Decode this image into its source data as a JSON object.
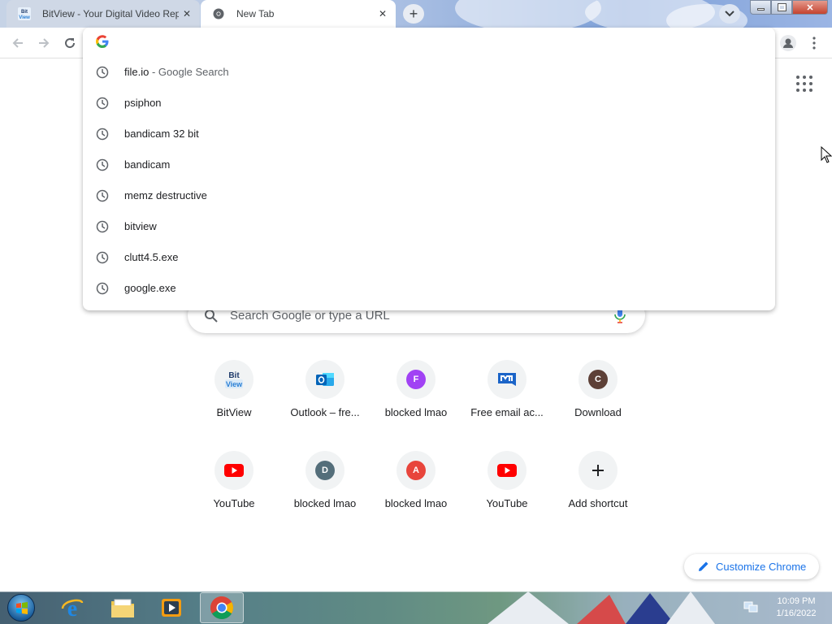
{
  "tabs": [
    {
      "title": "BitView - Your Digital Video Repository",
      "favicon": "bitview-logo",
      "active": false
    },
    {
      "title": "New Tab",
      "favicon": "chrome-icon",
      "active": true
    }
  ],
  "omnibox": {
    "value": "",
    "suggestions": [
      {
        "text": "file.io",
        "extra": " - Google Search",
        "icon": "history-clock-icon"
      },
      {
        "text": "psiphon",
        "extra": "",
        "icon": "history-clock-icon"
      },
      {
        "text": "bandicam 32 bit",
        "extra": "",
        "icon": "history-clock-icon"
      },
      {
        "text": "bandicam",
        "extra": "",
        "icon": "history-clock-icon"
      },
      {
        "text": "memz destructive",
        "extra": "",
        "icon": "history-clock-icon"
      },
      {
        "text": "bitview",
        "extra": "",
        "icon": "history-clock-icon"
      },
      {
        "text": "clutt4.5.exe",
        "extra": "",
        "icon": "history-clock-icon"
      },
      {
        "text": "google.exe",
        "extra": "",
        "icon": "history-clock-icon"
      }
    ]
  },
  "search": {
    "placeholder": "Search Google or type a URL"
  },
  "shortcuts": [
    {
      "label": "BitView",
      "icon": "bitview-logo"
    },
    {
      "label": "Outlook – fre...",
      "icon": "outlook-icon"
    },
    {
      "label": "blocked lmao",
      "icon": "letter-icon",
      "letter": "F",
      "color": "#a142f4"
    },
    {
      "label": "Free email ac...",
      "icon": "mail-com-icon"
    },
    {
      "label": "Download",
      "icon": "letter-icon",
      "letter": "C",
      "color": "#5d4037"
    },
    {
      "label": "YouTube",
      "icon": "youtube-icon"
    },
    {
      "label": "blocked lmao",
      "icon": "letter-icon",
      "letter": "D",
      "color": "#546e7a"
    },
    {
      "label": "blocked lmao",
      "icon": "letter-icon",
      "letter": "A",
      "color": "#e8453c"
    },
    {
      "label": "YouTube",
      "icon": "youtube-icon"
    },
    {
      "label": "Add shortcut",
      "icon": "plus-icon"
    }
  ],
  "customize": {
    "label": "Customize Chrome"
  },
  "taskbar": {
    "time": "10:09 PM",
    "date": "1/16/2022",
    "apps": [
      "internet-explorer-icon",
      "windows-explorer-icon",
      "media-player-icon",
      "chrome-icon"
    ]
  },
  "colors": {
    "accent": "#1a73e8",
    "youtube": "#ff0000"
  }
}
